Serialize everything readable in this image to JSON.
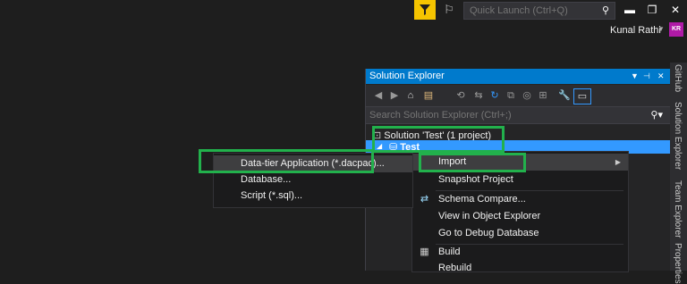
{
  "titlebar": {
    "quick_launch_placeholder": "Quick Launch (Ctrl+Q)",
    "user_name": "Kunal Rathi",
    "avatar_initials": "KR",
    "filter_color": "#f5c400"
  },
  "solution_explorer": {
    "title": "Solution Explorer",
    "search_placeholder": "Search Solution Explorer (Ctrl+;)",
    "solution_label": "Solution 'Test' (1 project)",
    "project_label": "Test"
  },
  "side_tabs": [
    "GitHub",
    "Solution Explorer",
    "Team Explorer",
    "Properties"
  ],
  "context_menu": {
    "items": [
      {
        "label": "Import",
        "has_submenu": true,
        "highlighted": true
      },
      {
        "label": "Snapshot Project"
      },
      {
        "label": "Schema Compare..."
      },
      {
        "label": "View in Object Explorer"
      },
      {
        "label": "Go to Debug Database"
      },
      {
        "label": "Build"
      },
      {
        "label": "Rebuild"
      }
    ]
  },
  "import_submenu": {
    "items": [
      {
        "label": "Data-tier Application (*.dacpac)...",
        "highlighted": true
      },
      {
        "label": "Database..."
      },
      {
        "label": "Script (*.sql)..."
      }
    ]
  },
  "colors": {
    "accent": "#007acc",
    "selection": "#3399ff",
    "highlight_box": "#22b14c",
    "avatar": "#b01aa7"
  }
}
